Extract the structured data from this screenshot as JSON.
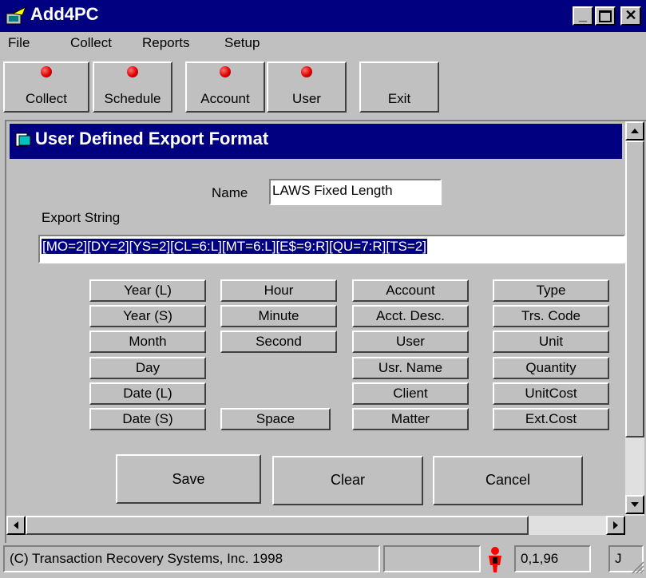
{
  "window": {
    "title": "Add4PC"
  },
  "menu": [
    "File",
    "Collect",
    "Reports",
    "Setup"
  ],
  "toolbar": {
    "collect_label": "Collect",
    "schedule_label": "Schedule",
    "account_label": "Account",
    "user_label": "User",
    "exit_label": "Exit"
  },
  "form": {
    "title": "User Defined Export Format",
    "name_label": "Name",
    "name_value": "LAWS Fixed Length",
    "export_label": "Export String",
    "export_value": "[MO=2][DY=2][YS=2][CL=6:L][MT=6:L][E$=9:R][QU=7:R][TS=2]"
  },
  "fields": {
    "col1": [
      "Year (L)",
      "Year (S)",
      "Month",
      "Day",
      "Date (L)",
      "Date (S)"
    ],
    "col2": [
      "Hour",
      "Minute",
      "Second",
      "Space"
    ],
    "col3": [
      "Account",
      "Acct. Desc.",
      "User",
      "Usr. Name",
      "Client",
      "Matter"
    ],
    "col4": [
      "Type",
      "Trs. Code",
      "Unit",
      "Quantity",
      "UnitCost",
      "Ext.Cost"
    ]
  },
  "actions": {
    "save": "Save",
    "clear": "Clear",
    "cancel": "Cancel"
  },
  "status": {
    "copyright": "(C) Transaction Recovery Systems, Inc. 1998",
    "version": "0,1,96",
    "user_initial": "J"
  }
}
